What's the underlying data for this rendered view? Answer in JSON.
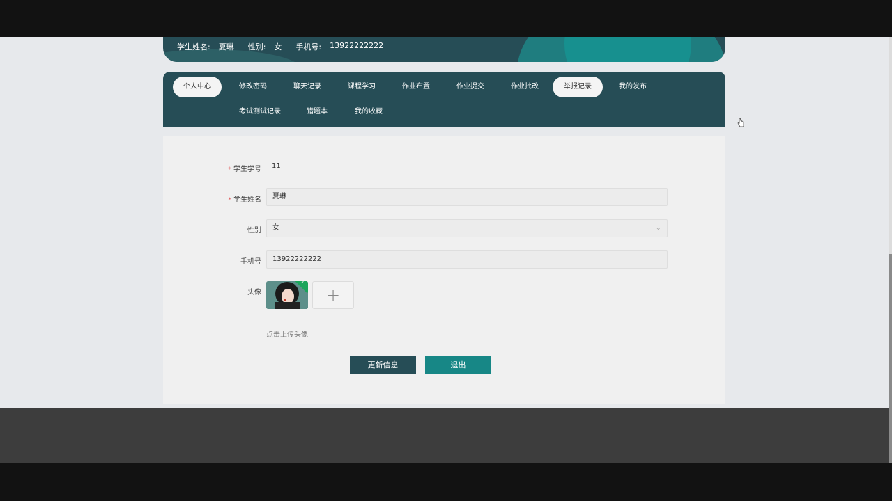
{
  "user_banner": {
    "name_label": "学生姓名:",
    "name_value": "夏琳",
    "gender_label": "性别:",
    "gender_value": "女",
    "phone_label": "手机号:",
    "phone_value": "13922222222"
  },
  "nav": {
    "items": [
      {
        "label": "个人中心",
        "active": true
      },
      {
        "label": "修改密码"
      },
      {
        "label": "聊天记录"
      },
      {
        "label": "课程学习"
      },
      {
        "label": "作业布置"
      },
      {
        "label": "作业提交"
      },
      {
        "label": "作业批改"
      },
      {
        "label": "举报记录",
        "hovered": true
      },
      {
        "label": "我的发布"
      },
      {
        "label": "考试测试记录"
      },
      {
        "label": "错题本"
      },
      {
        "label": "我的收藏"
      }
    ]
  },
  "form": {
    "student_id_label": "学生学号",
    "student_id_value": "11",
    "student_name_label": "学生姓名",
    "student_name_value": "夏琳",
    "gender_label": "性别",
    "gender_value": "女",
    "phone_label": "手机号",
    "phone_value": "13922222222",
    "avatar_label": "头像",
    "upload_plus": "+",
    "upload_tip": "点击上传头像",
    "required_mark": "*",
    "update_button": "更新信息",
    "logout_button": "退出"
  },
  "colors": {
    "primary_dark": "#264d56",
    "accent_teal": "#178786",
    "success_green": "#1aa55a"
  },
  "icons": {
    "select_arrow": "chevron-down-icon",
    "upload": "plus-icon",
    "avatar_status": "check-icon"
  }
}
